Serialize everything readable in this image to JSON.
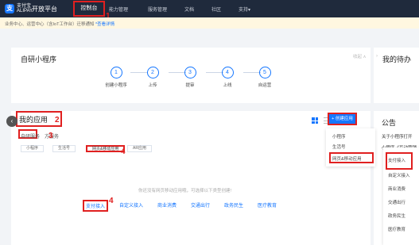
{
  "nav": {
    "logo_text": "支付宝\nALIPAY",
    "platform": "开放平台",
    "items": [
      "能力管理",
      "服务管理",
      "文档",
      "社区",
      "支持▾"
    ],
    "active": "控制台"
  },
  "notice": {
    "text": "业务中心、运营中心（含IoT工作台）迁移通知",
    "link": "*查看详情"
  },
  "steps_card": {
    "title": "自研小程序",
    "collapse": "收起 ∧",
    "steps": [
      {
        "num": "1",
        "label": "创建小程序"
      },
      {
        "num": "2",
        "label": "上传"
      },
      {
        "num": "3",
        "label": "提审"
      },
      {
        "num": "4",
        "label": "上线"
      },
      {
        "num": "5",
        "label": "自运营"
      }
    ]
  },
  "todo": {
    "title": "我的待办"
  },
  "announce": {
    "title": "公告",
    "lines": [
      "关于小程序打开",
      "小程序《互动营销"
    ]
  },
  "apps": {
    "title": "我的应用",
    "tab_self": "自研服务",
    "tab_third": "方服务",
    "chips": [
      "小程序",
      "生活号",
      "网页&移动应用",
      "AR应用"
    ],
    "empty_hint": "你还没有网页移动应用哦，可选择以下类型创建!",
    "industries": [
      "支付接入",
      "自定义接入",
      "商业消费",
      "交通出行",
      "政务民生",
      "医疗教育"
    ],
    "create_btn": "+ 创建应用"
  },
  "dropdown": {
    "items": [
      "小程序",
      "生活号",
      "网页&移动应用"
    ]
  },
  "submenu": {
    "items": [
      "支付接入",
      "自定义接入",
      "商业消费",
      "交通出行",
      "政务民生",
      "医疗教育"
    ]
  },
  "markers": [
    "1",
    "2",
    "3",
    "4",
    "4"
  ]
}
